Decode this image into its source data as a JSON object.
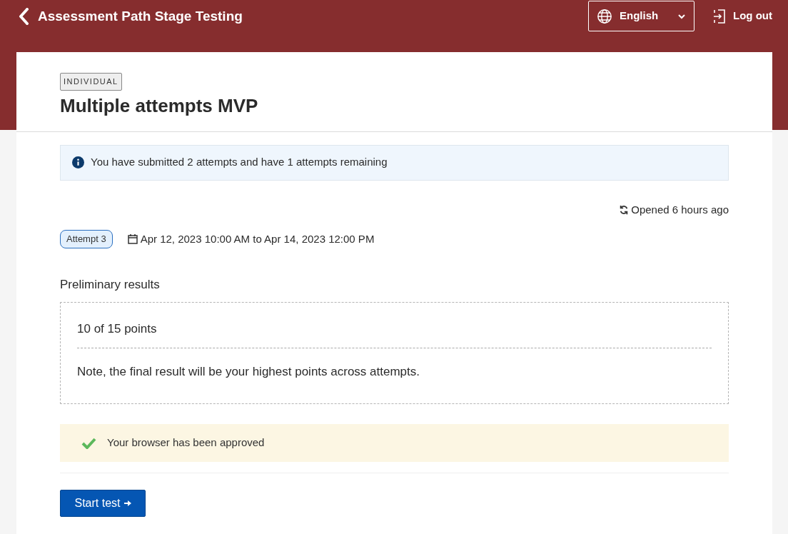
{
  "header": {
    "title": "Assessment Path Stage Testing",
    "language": "English",
    "logout": "Log out"
  },
  "assessment": {
    "type_badge": "INDIVIDUAL",
    "title": "Multiple attempts MVP"
  },
  "info_alert": "You have submitted 2 attempts and have 1 attempts remaining",
  "opened": "Opened 6 hours ago",
  "attempt": {
    "badge": "Attempt 3",
    "dates": "Apr 12, 2023 10:00 AM to Apr 14, 2023 12:00 PM"
  },
  "results": {
    "heading": "Preliminary results",
    "score": "10 of 15 points",
    "note": "Note, the final result will be your highest points across attempts."
  },
  "browser_check": {
    "approved": true,
    "message": "Your browser has been approved"
  },
  "start_button": "Start test"
}
